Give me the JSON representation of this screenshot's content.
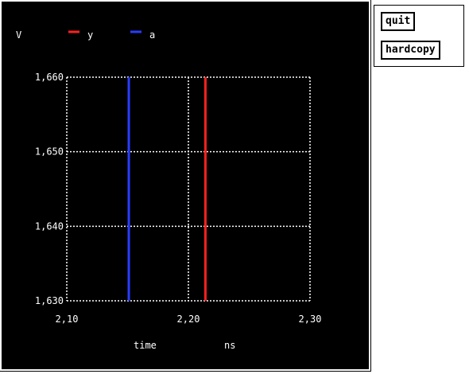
{
  "buttons": {
    "quit_label": "quit",
    "hardcopy_label": "hardcopy"
  },
  "colors": {
    "background": "#000000",
    "grid": "#ffffff",
    "y": "#ff2020",
    "a": "#2a3cff"
  },
  "chart_data": {
    "type": "line",
    "ylabel": "V",
    "xlabel": "time",
    "xunit": "ns",
    "xlim": [
      2.1,
      2.3
    ],
    "ylim": [
      1.63,
      1.66
    ],
    "x_ticks": [
      "2,10",
      "2,20",
      "2,30"
    ],
    "x_tick_values": [
      2.1,
      2.2,
      2.3
    ],
    "y_ticks": [
      "1,660",
      "1,650",
      "1,640",
      "1,630"
    ],
    "y_tick_values": [
      1.66,
      1.65,
      1.64,
      1.63
    ],
    "grid": true,
    "legend_position": "top",
    "series": [
      {
        "name": "y",
        "color": "#ff2020",
        "x": [
          2.214,
          2.214
        ],
        "y": [
          1.63,
          1.66
        ]
      },
      {
        "name": "a",
        "color": "#2a3cff",
        "x": [
          2.151,
          2.151
        ],
        "y": [
          1.63,
          1.66
        ]
      }
    ]
  }
}
